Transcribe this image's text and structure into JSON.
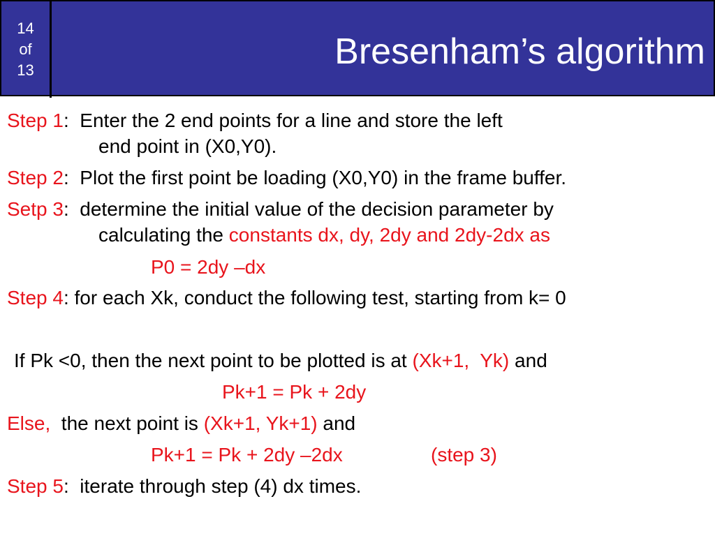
{
  "slide": {
    "page_number": "14",
    "page_of": "of",
    "page_total": "13",
    "title": "Bresenham’s algorithm"
  },
  "colors": {
    "header_bg": "#333399",
    "accent_red": "#e8141c",
    "text": "#000000"
  },
  "body": {
    "step1_label": "Step 1",
    "step1_text": ":  Enter the 2 end points for a line and store the left",
    "step1_cont": "end point in (X0,Y0).",
    "step2_label": "Step 2",
    "step2_text": ":  Plot the first point be loading (X0,Y0) in the frame buffer.",
    "step3_label": "Setp 3",
    "step3_text": ":  determine the initial value of the decision parameter by",
    "step3_cont_plain": "calculating the ",
    "step3_cont_red": "constants dx, dy, 2dy and 2dy-2dx as",
    "p0_formula": "P0 = 2dy –dx",
    "step4_label": "Step 4",
    "step4_text": ": for each Xk, conduct the following test, starting from k= 0",
    "if_text": "If Pk <0, then the next point to be plotted is at ",
    "if_point": "(Xk+1,  Yk)",
    "if_and": " and",
    "if_formula": "Pk+1 = Pk + 2dy",
    "else_label": "Else,",
    "else_text": "  the next point is ",
    "else_point": "(Xk+1, Yk+1)",
    "else_and": " and",
    "else_formula": "Pk+1 = Pk + 2dy –2dx",
    "else_ref": "(step 3)",
    "step5_label": "Step 5",
    "step5_text": ":  iterate through step (4) dx times."
  }
}
